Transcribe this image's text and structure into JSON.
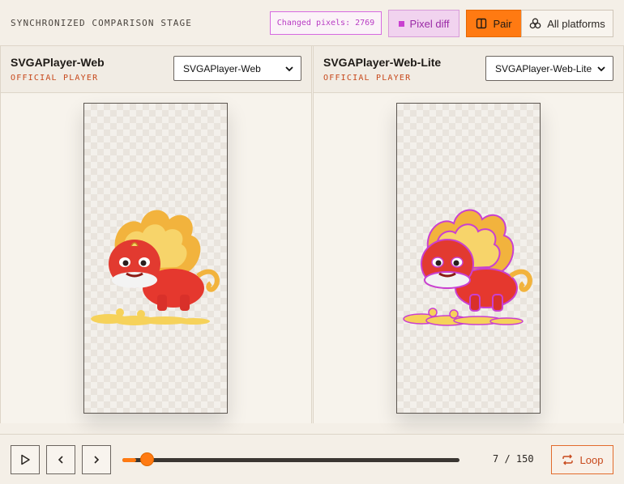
{
  "header": {
    "title": "SYNCHRONIZED COMPARISON STAGE",
    "changed_pixels_label": "Changed pixels: 2769",
    "pixel_diff_label": "Pixel diff",
    "pair_label": "Pair",
    "all_platforms_label": "All platforms"
  },
  "panels": [
    {
      "title": "SVGAPlayer-Web",
      "subtitle": "OFFICIAL PLAYER",
      "selected": "SVGAPlayer-Web"
    },
    {
      "title": "SVGAPlayer-Web-Lite",
      "subtitle": "OFFICIAL PLAYER",
      "selected": "SVGAPlayer-Web-Lite"
    }
  ],
  "playback": {
    "frame_text": "7 / 150",
    "current_frame": 7,
    "total_frames": 150,
    "loop_label": "Loop"
  },
  "colors": {
    "accent": "#ff7a12",
    "diff": "#c940d0",
    "subtitle": "#c7481b"
  },
  "icons": {
    "pair": "split-panel-icon",
    "all_platforms": "three-circles-icon",
    "play": "play-icon",
    "prev": "chevron-left-icon",
    "next": "chevron-right-icon",
    "loop": "repeat-icon",
    "select": "chevron-down-icon"
  }
}
